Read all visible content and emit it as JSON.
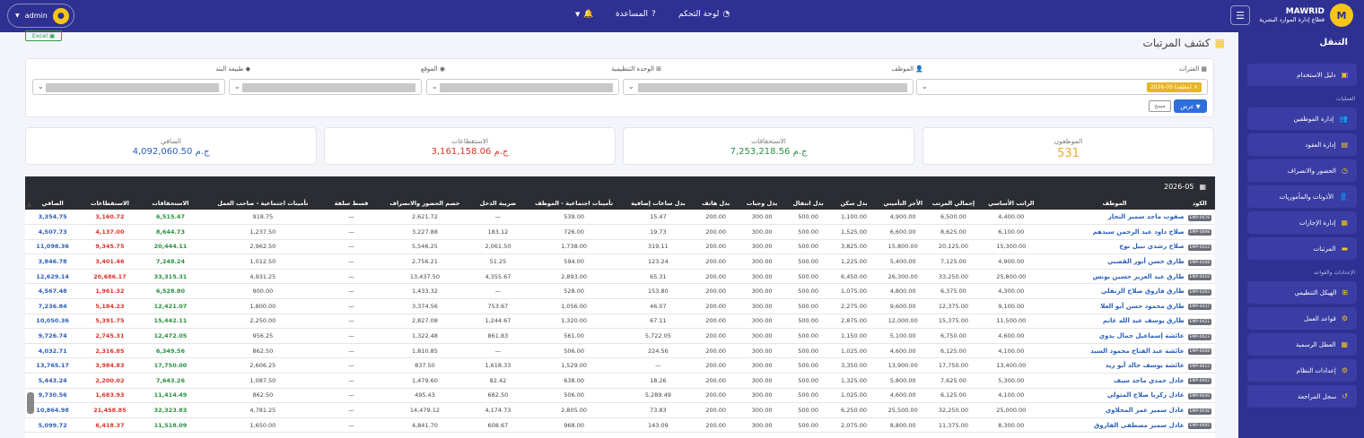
{
  "topbar": {
    "brand_name": "MAWRID",
    "brand_sub": "قطاع إدارة الموارد البشرية",
    "brand_initial": "M",
    "dashboard": "لوحة التحكم",
    "help": "المساعدة",
    "user": "admin"
  },
  "sidebar": {
    "header": "التنقل",
    "guide": "دليل الاستخدام",
    "sec_ops": "العمليات",
    "ops": [
      "إدارة الموظفين",
      "إدارة العقود",
      "الحضور والانصراف",
      "الأذونات والمأموريات",
      "إدارة الإجازات",
      "المرتبات"
    ],
    "sec_settings": "الإعدادات والقواعد",
    "settings": [
      "الهيكل التنظيمي",
      "قواعد العمل",
      "العطل الرسمية",
      "إعدادات النظام",
      "سجل المراجعة"
    ]
  },
  "page": {
    "title": "كشف المرتبات",
    "excel": "Excel"
  },
  "filters": {
    "period_label": "الفترات",
    "period_chip": "2026-05 (مغلقة)",
    "employee_label": "الموظف",
    "unit_label": "الوحدة التنظيمية",
    "location_label": "الموقع",
    "item_label": "طبيعة البند",
    "show": "عرض",
    "clear": "مسح"
  },
  "summary": {
    "employees_label": "الموظفون",
    "employees": "531",
    "gross_label": "الاستحقاقات",
    "gross": "7,253,218.56 ج.م",
    "ded_label": "الاستقطاعات",
    "ded": "3,161,158.06 ج.م",
    "net_label": "الصافي",
    "net": "4,092,060.50 ج.م"
  },
  "table": {
    "period": "2026-05",
    "columns": [
      "الكود",
      "الموظف",
      "الراتب الأساسي",
      "إجمالي المرتب",
      "الأجر التأميني",
      "بدل سكن",
      "بدل انتقال",
      "بدل وجبات",
      "بدل هاتف",
      "بدل ساعات إضافية",
      "تأمينات اجتماعية - الموظف",
      "ضريبة الدخل",
      "خصم الحضور والانصراف",
      "قسط سلفة",
      "تأمينات اجتماعية - صاحب العمل",
      "الاستحقاقات",
      "الاستقطاعات",
      "الصافي"
    ],
    "rows": [
      [
        "EMP-0676",
        "صفوت ماجد سمير النجار",
        "4,400.00",
        "6,500.00",
        "4,900.00",
        "1,100.00",
        "500.00",
        "300.00",
        "200.00",
        "15.47",
        "539.00",
        "—",
        "2,621.72",
        "—",
        "918.75",
        "6,515.47",
        "3,160.72",
        "3,354.75"
      ],
      [
        "EMP-0698",
        "صلاح داود عبد الرحمن سيدهم",
        "6,100.00",
        "8,625.00",
        "6,600.00",
        "1,525.00",
        "500.00",
        "300.00",
        "200.00",
        "19.73",
        "726.00",
        "183.12",
        "3,227.88",
        "—",
        "1,237.50",
        "8,644.73",
        "4,137.00",
        "4,507.73"
      ],
      [
        "EMP-0033",
        "صلاح رشدي نبيل نوح",
        "15,300.00",
        "20,125.00",
        "15,800.00",
        "3,825.00",
        "500.00",
        "300.00",
        "200.00",
        "319.11",
        "1,738.00",
        "2,061.50",
        "5,546.25",
        "—",
        "2,962.50",
        "20,444.11",
        "9,345.75",
        "11,098.36"
      ],
      [
        "EMP-0208",
        "طارق حسن أنور القصبي",
        "4,900.00",
        "7,125.00",
        "5,400.00",
        "1,225.00",
        "500.00",
        "300.00",
        "200.00",
        "123.24",
        "594.00",
        "51.25",
        "2,756.21",
        "—",
        "1,012.50",
        "7,248.24",
        "3,401.46",
        "3,846.78"
      ],
      [
        "EMP-0010",
        "طارق عبد العزيز حسين يونس",
        "25,800.00",
        "33,250.00",
        "26,300.00",
        "6,450.00",
        "500.00",
        "300.00",
        "200.00",
        "65.31",
        "2,893.00",
        "4,355.67",
        "13,437.50",
        "—",
        "4,931.25",
        "33,315.31",
        "20,686.17",
        "12,629.14"
      ],
      [
        "EMP-0265",
        "طارق فاروق صلاح الزنفلي",
        "4,300.00",
        "6,375.00",
        "4,800.00",
        "1,075.00",
        "500.00",
        "300.00",
        "200.00",
        "153.80",
        "528.00",
        "—",
        "1,433.32",
        "—",
        "900.00",
        "6,528.80",
        "1,961.32",
        "4,567.48"
      ],
      [
        "EMP-0437",
        "طارق محمود حسن أبو العلا",
        "9,100.00",
        "12,375.00",
        "9,600.00",
        "2,275.00",
        "500.00",
        "300.00",
        "200.00",
        "46.07",
        "1,056.00",
        "753.67",
        "3,374.56",
        "—",
        "1,800.00",
        "12,421.07",
        "5,184.23",
        "7,236.84"
      ],
      [
        "EMP-0421",
        "طارق يوسف عبد الله غانم",
        "11,500.00",
        "15,375.00",
        "12,000.00",
        "2,875.00",
        "500.00",
        "300.00",
        "200.00",
        "67.11",
        "1,320.00",
        "1,244.67",
        "2,827.08",
        "—",
        "2,250.00",
        "15,442.11",
        "5,391.75",
        "10,050.36"
      ],
      [
        "EMP-0623",
        "عائشة إسماعيل جمال بدوي",
        "4,600.00",
        "6,750.00",
        "5,100.00",
        "1,150.00",
        "500.00",
        "300.00",
        "200.00",
        "5,722.05",
        "561.00",
        "861.83",
        "1,322.48",
        "—",
        "956.25",
        "12,472.05",
        "2,745.31",
        "9,726.74"
      ],
      [
        "EMP-0008",
        "عائشة عبد الفتاح محمود السيد",
        "4,100.00",
        "6,125.00",
        "4,600.00",
        "1,025.00",
        "500.00",
        "300.00",
        "200.00",
        "224.56",
        "506.00",
        "—",
        "1,810.85",
        "—",
        "862.50",
        "6,349.56",
        "2,316.85",
        "4,032.71"
      ],
      [
        "EMP-0615",
        "عائشة يوسف خالد أبو زيد",
        "13,400.00",
        "17,750.00",
        "13,900.00",
        "3,350.00",
        "500.00",
        "300.00",
        "200.00",
        "—",
        "1,529.00",
        "1,618.33",
        "837.50",
        "—",
        "2,606.25",
        "17,750.00",
        "3,984.83",
        "13,765.17"
      ],
      [
        "EMP-0062",
        "عادل حمدي ماجد سيف",
        "5,300.00",
        "7,625.00",
        "5,800.00",
        "1,325.00",
        "500.00",
        "300.00",
        "200.00",
        "18.26",
        "638.00",
        "82.42",
        "1,479.60",
        "—",
        "1,087.50",
        "7,643.26",
        "2,200.02",
        "5,443.24"
      ],
      [
        "EMP-0640",
        "عادل زكريا صلاح المتولي",
        "4,100.00",
        "6,125.00",
        "4,600.00",
        "1,025.00",
        "500.00",
        "300.00",
        "200.00",
        "5,289.49",
        "506.00",
        "682.50",
        "495.43",
        "—",
        "862.50",
        "11,414.49",
        "1,683.93",
        "9,730.56"
      ],
      [
        "EMP-0036",
        "عادل سمير عمر المحلاوي",
        "25,000.00",
        "32,250.00",
        "25,500.00",
        "6,250.00",
        "500.00",
        "300.00",
        "200.00",
        "73.83",
        "2,805.00",
        "4,174.73",
        "14,479.12",
        "—",
        "4,781.25",
        "32,323.83",
        "21,458.85",
        "10,864.98"
      ],
      [
        "EMP-0695",
        "عادل سمير مصطفى الفاروق",
        "8,300.00",
        "11,375.00",
        "8,800.00",
        "2,075.00",
        "500.00",
        "300.00",
        "200.00",
        "143.09",
        "968.00",
        "608.67",
        "4,841.70",
        "—",
        "1,650.00",
        "11,518.09",
        "6,418.37",
        "5,099.72"
      ]
    ]
  }
}
